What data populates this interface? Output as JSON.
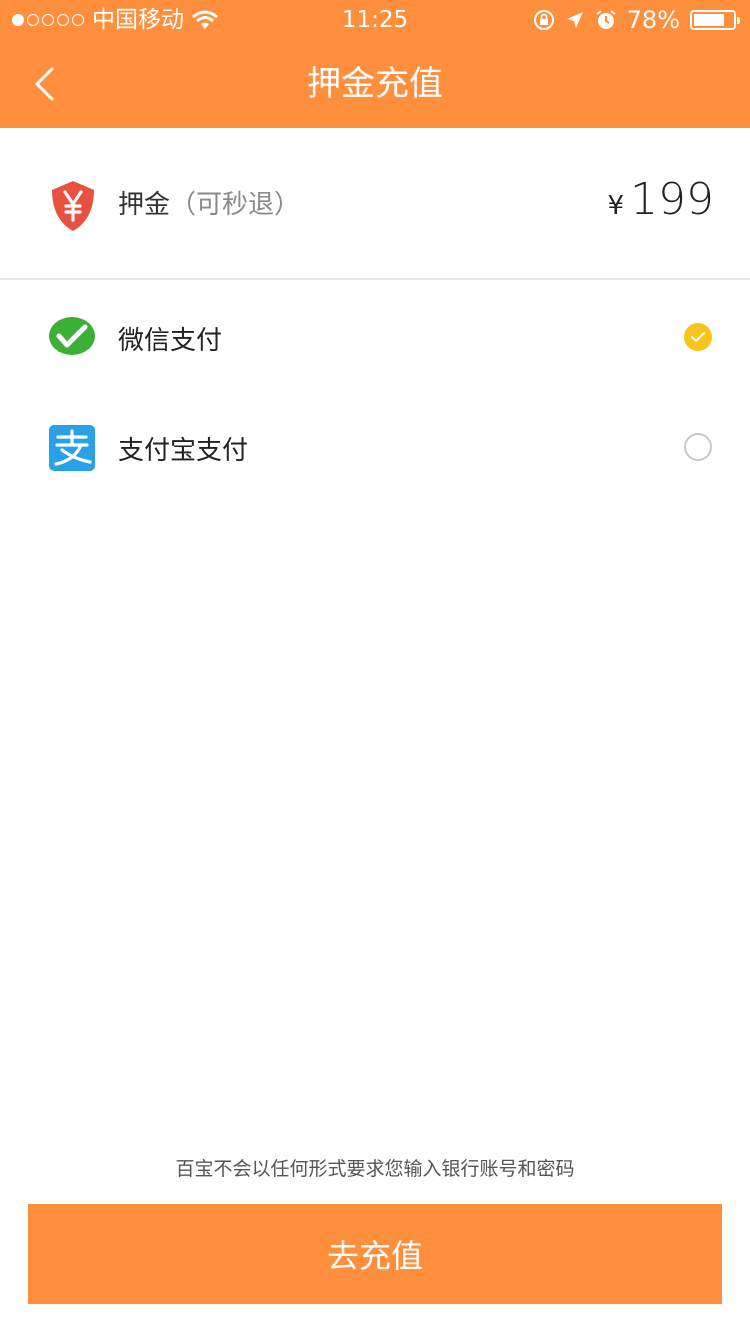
{
  "status_bar": {
    "carrier": "中国移动",
    "time": "11:25",
    "battery_percent": "78%",
    "battery_level": 0.78,
    "signal_filled": 1,
    "signal_total": 5
  },
  "nav": {
    "title": "押金充值",
    "back_icon": "chevron-left-icon"
  },
  "deposit": {
    "label": "押金",
    "note": "（可秒退）",
    "currency": "¥",
    "amount": "199",
    "icon": "shield-yen-icon",
    "icon_color": "#E8503F"
  },
  "payment_methods": [
    {
      "label": "微信支付",
      "icon": "wechat-pay-icon",
      "icon_color": "#3CB034",
      "selected": true
    },
    {
      "label": "支付宝支付",
      "icon": "alipay-icon",
      "icon_color": "#29A1E8",
      "selected": false
    }
  ],
  "notice": "百宝不会以任何形式要求您输入银行账号和密码",
  "submit_label": "去充值",
  "colors": {
    "accent": "#FF8F3D",
    "radio_selected": "#F9C51B"
  }
}
